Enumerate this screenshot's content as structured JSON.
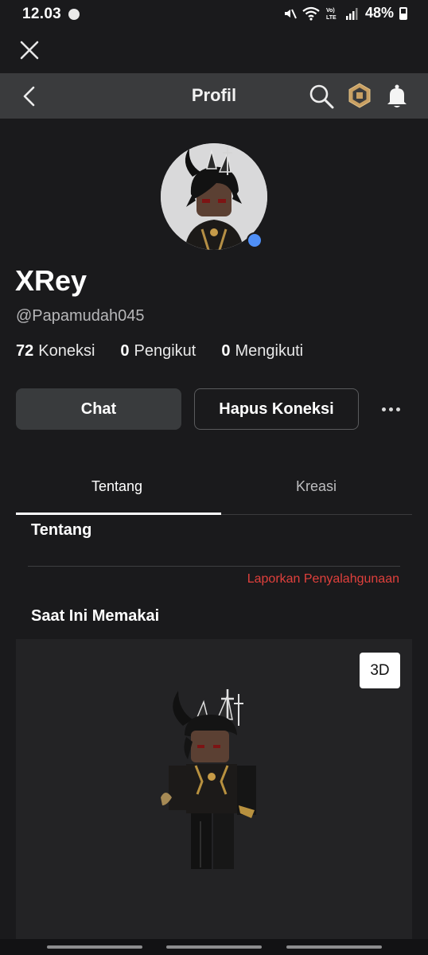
{
  "status_bar": {
    "time": "12.03",
    "battery_percent": "48%",
    "icons": [
      "mute-icon",
      "wifi-icon",
      "volte-icon",
      "signal-icon",
      "battery-icon"
    ]
  },
  "app_bar": {
    "title": "Profil",
    "icons": [
      "back-icon",
      "search-icon",
      "robux-icon",
      "bell-icon"
    ]
  },
  "profile": {
    "display_name": "XRey",
    "username": "@Papamudah045",
    "online": true,
    "stats": [
      {
        "count": "72",
        "label": "Koneksi"
      },
      {
        "count": "0",
        "label": "Pengikut"
      },
      {
        "count": "0",
        "label": "Mengikuti"
      }
    ]
  },
  "actions": {
    "chat_label": "Chat",
    "remove_connection_label": "Hapus Koneksi"
  },
  "tabs": [
    {
      "label": "Tentang",
      "active": true
    },
    {
      "label": "Kreasi",
      "active": false
    }
  ],
  "about": {
    "title": "Tentang",
    "report_label": "Laporkan Penyalahgunaan"
  },
  "wearing": {
    "title": "Saat Ini Memakai",
    "view_3d_label": "3D"
  },
  "colors": {
    "background": "#1a1a1c",
    "app_bar": "#3a3b3d",
    "online": "#4f8ff7",
    "report": "#e0403c",
    "panel": "#232325"
  }
}
